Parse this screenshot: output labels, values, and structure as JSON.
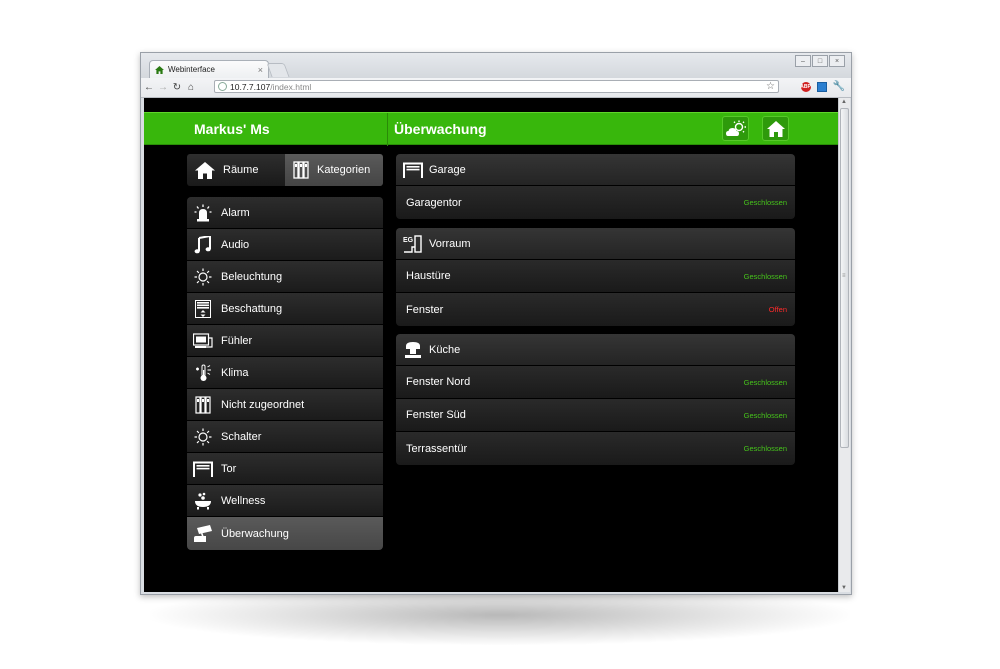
{
  "browser": {
    "tab_title": "Webinterface",
    "tab_close": "×",
    "url_host": "10.7.7.107",
    "url_path": "/index.html",
    "window_controls": [
      "–",
      "□",
      "×"
    ],
    "adblock_label": "ABP"
  },
  "header": {
    "app_title": "Markus' Ms",
    "page_title": "Überwachung",
    "buttons": [
      "weather-icon",
      "home-icon"
    ]
  },
  "segmented": {
    "rooms": "Räume",
    "categories": "Kategorien",
    "selected": "categories"
  },
  "categories": [
    {
      "label": "Alarm",
      "icon": "alarm-siren-icon"
    },
    {
      "label": "Audio",
      "icon": "music-note-icon"
    },
    {
      "label": "Beleuchtung",
      "icon": "light-sun-icon"
    },
    {
      "label": "Beschattung",
      "icon": "blinds-icon"
    },
    {
      "label": "Fühler",
      "icon": "sensor-icon"
    },
    {
      "label": "Klima",
      "icon": "thermometer-icon"
    },
    {
      "label": "Nicht zugeordnet",
      "icon": "unassigned-icon"
    },
    {
      "label": "Schalter",
      "icon": "switch-sun-icon"
    },
    {
      "label": "Tor",
      "icon": "gate-icon"
    },
    {
      "label": "Wellness",
      "icon": "wellness-icon"
    },
    {
      "label": "Überwachung",
      "icon": "camera-icon",
      "active": true
    }
  ],
  "groups": [
    {
      "title": "Garage",
      "icon": "garage-icon",
      "items": [
        {
          "label": "Garagentor",
          "status": "Geschlossen",
          "state": "closed"
        }
      ]
    },
    {
      "title": "Vorraum",
      "icon": "entry-icon",
      "badge": "EG",
      "items": [
        {
          "label": "Haustüre",
          "status": "Geschlossen",
          "state": "closed"
        },
        {
          "label": "Fenster",
          "status": "Offen",
          "state": "open"
        }
      ]
    },
    {
      "title": "Küche",
      "icon": "kitchen-icon",
      "items": [
        {
          "label": "Fenster Nord",
          "status": "Geschlossen",
          "state": "closed"
        },
        {
          "label": "Fenster Süd",
          "status": "Geschlossen",
          "state": "closed"
        },
        {
          "label": "Terrassentür",
          "status": "Geschlossen",
          "state": "closed"
        }
      ]
    }
  ],
  "colors": {
    "accent": "#38b70c",
    "closed": "#46c31b",
    "open": "#ff2a2a"
  }
}
